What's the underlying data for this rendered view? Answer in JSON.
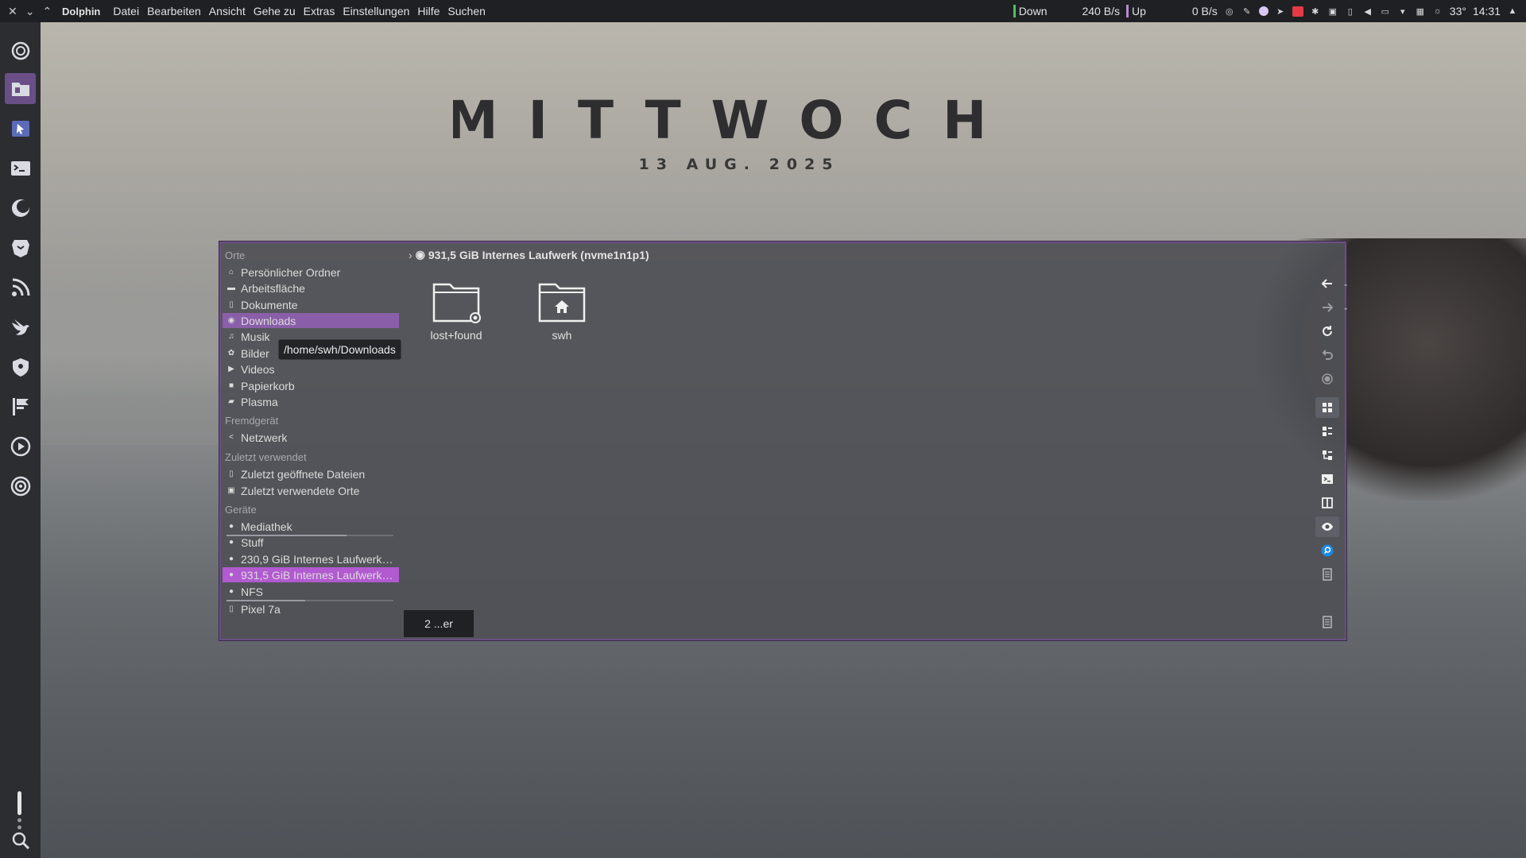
{
  "topbar": {
    "app_name": "Dolphin",
    "menu": [
      "Datei",
      "Bearbeiten",
      "Ansicht",
      "Gehe zu",
      "Extras",
      "Einstellungen",
      "Hilfe",
      "Suchen"
    ],
    "net_down_label": "Down",
    "net_down_value": "240 B/s",
    "net_up_label": "Up",
    "net_up_value": "0 B/s",
    "temperature": "33°",
    "time": "14:31"
  },
  "clock_widget": {
    "weekday": "MITTWOCH",
    "date": "13 AUG. 2025"
  },
  "dock": {
    "items": [
      "settings-icon",
      "folder-icon",
      "cursor-app-icon",
      "terminal-icon",
      "moon-icon",
      "lion-browser-icon",
      "rss-icon",
      "swift-bird-icon",
      "shield-icon",
      "flag-icon",
      "play-icon",
      "target-icon"
    ],
    "search_icon": "search-icon"
  },
  "dolphin": {
    "breadcrumb": "931,5 GiB Internes Laufwerk (nvme1n1p1)",
    "tooltip": "/home/swh/Downloads",
    "status": "2 ...er",
    "sections": {
      "places": "Orte",
      "remote": "Fremdgerät",
      "recent": "Zuletzt verwendet",
      "devices": "Geräte"
    },
    "places": [
      {
        "label": "Persönlicher Ordner",
        "icon": "home-icon"
      },
      {
        "label": "Arbeitsfläche",
        "icon": "desktop-icon"
      },
      {
        "label": "Dokumente",
        "icon": "document-icon"
      },
      {
        "label": "Downloads",
        "icon": "download-icon"
      },
      {
        "label": "Musik",
        "icon": "music-icon"
      },
      {
        "label": "Bilder",
        "icon": "picture-icon"
      },
      {
        "label": "Videos",
        "icon": "video-icon"
      },
      {
        "label": "Papierkorb",
        "icon": "trash-icon"
      },
      {
        "label": "Plasma",
        "icon": "folder-icon"
      }
    ],
    "remote": [
      {
        "label": "Netzwerk",
        "icon": "network-icon"
      }
    ],
    "recent": [
      {
        "label": "Zuletzt geöffnete Dateien",
        "icon": "recent-files-icon"
      },
      {
        "label": "Zuletzt verwendete Orte",
        "icon": "recent-places-icon"
      }
    ],
    "devices": [
      {
        "label": "Mediathek",
        "icon": "drive-icon",
        "usage": 0.72
      },
      {
        "label": "Stuff",
        "icon": "drive-icon",
        "usage": 0.0
      },
      {
        "label": "230,9 GiB Internes Laufwerk ...",
        "icon": "drive-icon",
        "usage": 0.0
      },
      {
        "label": "931,5 GiB Internes Laufwerk ...",
        "icon": "drive-icon",
        "usage": 0.0
      },
      {
        "label": "NFS",
        "icon": "drive-icon",
        "usage": 0.47
      },
      {
        "label": "Pixel 7a",
        "icon": "phone-icon",
        "usage": 0.0
      }
    ],
    "files": [
      {
        "name": "lost+found",
        "icon": "folder-lock-icon"
      },
      {
        "name": "swh",
        "icon": "folder-home-icon"
      }
    ],
    "toolbar": [
      "back-icon",
      "forward-icon",
      "reload-icon",
      "undo-icon",
      "record-icon",
      "icon-view-icon",
      "details-view-icon",
      "tree-view-icon",
      "terminal-icon",
      "split-view-icon",
      "preview-icon",
      "search-icon",
      "document-icon",
      "info-panel-icon"
    ]
  }
}
